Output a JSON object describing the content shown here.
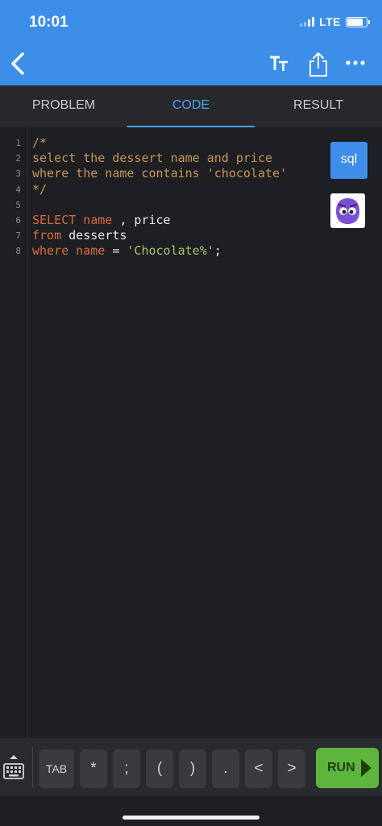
{
  "status_bar": {
    "time": "10:01",
    "network": "LTE"
  },
  "nav": {
    "icons": [
      "back-icon",
      "text-size-icon",
      "share-icon",
      "more-icon"
    ]
  },
  "tabs": [
    {
      "label": "PROBLEM",
      "active": false
    },
    {
      "label": "CODE",
      "active": true
    },
    {
      "label": "RESULT",
      "active": false
    }
  ],
  "editor": {
    "language_badge": "sql",
    "lines": [
      {
        "n": "1",
        "parts": [
          {
            "t": "/*",
            "k": "comment"
          }
        ]
      },
      {
        "n": "2",
        "parts": [
          {
            "t": "select the dessert name and price",
            "k": "comment"
          }
        ]
      },
      {
        "n": "3",
        "parts": [
          {
            "t": "where the name contains 'chocolate'",
            "k": "comment"
          }
        ]
      },
      {
        "n": "4",
        "parts": [
          {
            "t": "*/",
            "k": "comment"
          }
        ]
      },
      {
        "n": "5",
        "parts": []
      },
      {
        "n": "6",
        "parts": [
          {
            "t": "SELECT",
            "k": "kw"
          },
          {
            "t": " name ",
            "k": "kw"
          },
          {
            "t": ", price",
            "k": "id"
          }
        ]
      },
      {
        "n": "7",
        "parts": [
          {
            "t": "from",
            "k": "kw"
          },
          {
            "t": " desserts",
            "k": "id"
          }
        ]
      },
      {
        "n": "8",
        "parts": [
          {
            "t": "where",
            "k": "kw"
          },
          {
            "t": " name ",
            "k": "kw"
          },
          {
            "t": "= ",
            "k": "id"
          },
          {
            "t": "'Chocolate%'",
            "k": "str"
          },
          {
            "t": ";",
            "k": "id"
          }
        ]
      }
    ]
  },
  "toolbar": {
    "keys": [
      "TAB",
      "*",
      ";",
      "(",
      ")",
      ".",
      "<",
      ">"
    ],
    "run_label": "RUN"
  },
  "colors": {
    "accent": "#3d8ee8",
    "active_tab": "#4aa0f0",
    "run": "#5db53d",
    "comment": "#c79559",
    "keyword": "#d96b3f",
    "string": "#a8c26a"
  }
}
